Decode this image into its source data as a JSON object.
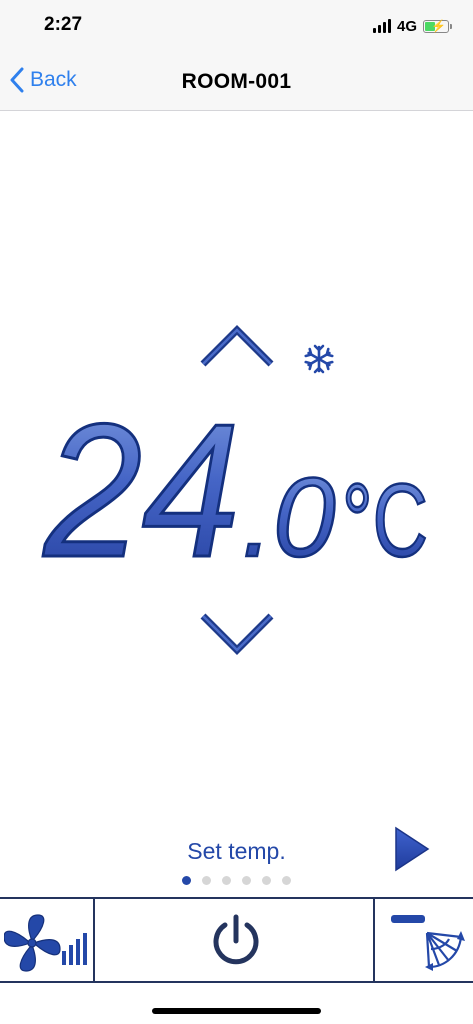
{
  "status_bar": {
    "time": "2:27",
    "network": "4G"
  },
  "nav": {
    "back_label": "Back",
    "title": "ROOM-001"
  },
  "thermostat": {
    "temp_integer": "24",
    "temp_decimal": ".0",
    "unit": "°C",
    "mode_icon": "snowflake-icon",
    "label": "Set temp.",
    "page_count": 6,
    "active_page": 1
  },
  "toolbar": {
    "fan_icon": "fan-speed-icon",
    "power_icon": "power-icon",
    "swing_icon": "louver-swing-icon"
  },
  "colors": {
    "accent": "#2f80ed",
    "brand_blue": "#2448a8",
    "border": "#24345e"
  }
}
